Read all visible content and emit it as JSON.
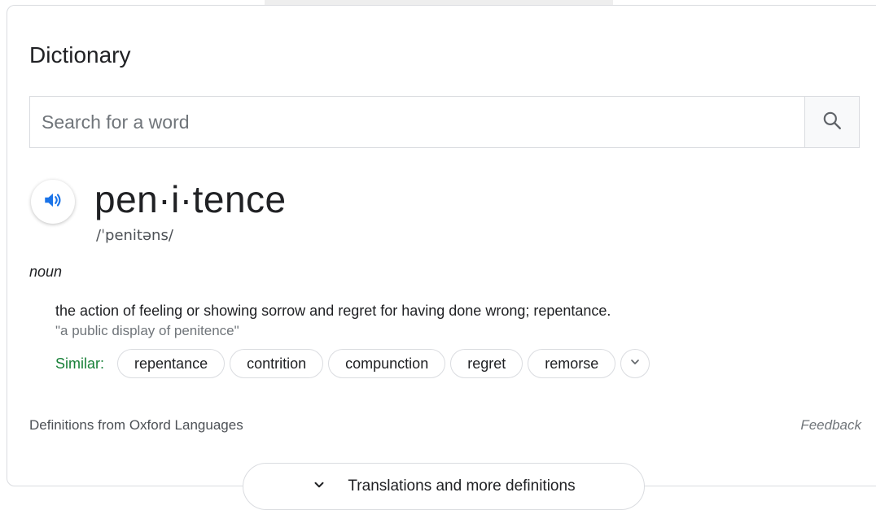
{
  "dictionary": {
    "title": "Dictionary",
    "search": {
      "placeholder": "Search for a word",
      "value": "",
      "button_icon": "search-icon"
    },
    "entry": {
      "word": "pen·i·tence",
      "pronunciation": "/ˈpenitəns/",
      "audio_icon": "speaker-icon",
      "part_of_speech": "noun",
      "definition": "the action of feeling or showing sorrow and regret for having done wrong; repentance.",
      "example": "\"a public display of penitence\"",
      "similar_label": "Similar:",
      "similar": [
        "repentance",
        "contrition",
        "compunction",
        "regret",
        "remorse"
      ],
      "more_icon": "chevron-down-icon"
    },
    "source": "Definitions from Oxford Languages",
    "feedback": "Feedback",
    "more_button": "Translations and more definitions"
  },
  "colors": {
    "accent_blue": "#1a73e8",
    "similar_green": "#188038",
    "border": "#dadce0",
    "muted_text": "#70757a"
  }
}
